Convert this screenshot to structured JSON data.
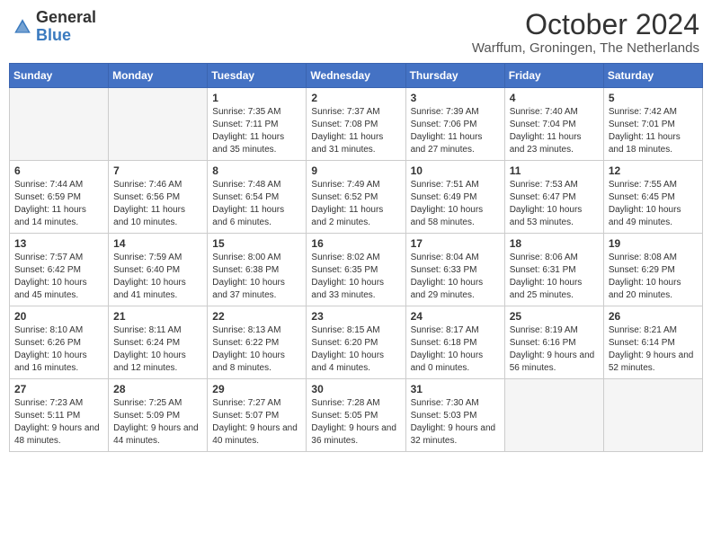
{
  "header": {
    "logo_general": "General",
    "logo_blue": "Blue",
    "month_title": "October 2024",
    "location": "Warffum, Groningen, The Netherlands"
  },
  "days_of_week": [
    "Sunday",
    "Monday",
    "Tuesday",
    "Wednesday",
    "Thursday",
    "Friday",
    "Saturday"
  ],
  "weeks": [
    [
      {
        "day": "",
        "info": ""
      },
      {
        "day": "",
        "info": ""
      },
      {
        "day": "1",
        "info": "Sunrise: 7:35 AM\nSunset: 7:11 PM\nDaylight: 11 hours and 35 minutes."
      },
      {
        "day": "2",
        "info": "Sunrise: 7:37 AM\nSunset: 7:08 PM\nDaylight: 11 hours and 31 minutes."
      },
      {
        "day": "3",
        "info": "Sunrise: 7:39 AM\nSunset: 7:06 PM\nDaylight: 11 hours and 27 minutes."
      },
      {
        "day": "4",
        "info": "Sunrise: 7:40 AM\nSunset: 7:04 PM\nDaylight: 11 hours and 23 minutes."
      },
      {
        "day": "5",
        "info": "Sunrise: 7:42 AM\nSunset: 7:01 PM\nDaylight: 11 hours and 18 minutes."
      }
    ],
    [
      {
        "day": "6",
        "info": "Sunrise: 7:44 AM\nSunset: 6:59 PM\nDaylight: 11 hours and 14 minutes."
      },
      {
        "day": "7",
        "info": "Sunrise: 7:46 AM\nSunset: 6:56 PM\nDaylight: 11 hours and 10 minutes."
      },
      {
        "day": "8",
        "info": "Sunrise: 7:48 AM\nSunset: 6:54 PM\nDaylight: 11 hours and 6 minutes."
      },
      {
        "day": "9",
        "info": "Sunrise: 7:49 AM\nSunset: 6:52 PM\nDaylight: 11 hours and 2 minutes."
      },
      {
        "day": "10",
        "info": "Sunrise: 7:51 AM\nSunset: 6:49 PM\nDaylight: 10 hours and 58 minutes."
      },
      {
        "day": "11",
        "info": "Sunrise: 7:53 AM\nSunset: 6:47 PM\nDaylight: 10 hours and 53 minutes."
      },
      {
        "day": "12",
        "info": "Sunrise: 7:55 AM\nSunset: 6:45 PM\nDaylight: 10 hours and 49 minutes."
      }
    ],
    [
      {
        "day": "13",
        "info": "Sunrise: 7:57 AM\nSunset: 6:42 PM\nDaylight: 10 hours and 45 minutes."
      },
      {
        "day": "14",
        "info": "Sunrise: 7:59 AM\nSunset: 6:40 PM\nDaylight: 10 hours and 41 minutes."
      },
      {
        "day": "15",
        "info": "Sunrise: 8:00 AM\nSunset: 6:38 PM\nDaylight: 10 hours and 37 minutes."
      },
      {
        "day": "16",
        "info": "Sunrise: 8:02 AM\nSunset: 6:35 PM\nDaylight: 10 hours and 33 minutes."
      },
      {
        "day": "17",
        "info": "Sunrise: 8:04 AM\nSunset: 6:33 PM\nDaylight: 10 hours and 29 minutes."
      },
      {
        "day": "18",
        "info": "Sunrise: 8:06 AM\nSunset: 6:31 PM\nDaylight: 10 hours and 25 minutes."
      },
      {
        "day": "19",
        "info": "Sunrise: 8:08 AM\nSunset: 6:29 PM\nDaylight: 10 hours and 20 minutes."
      }
    ],
    [
      {
        "day": "20",
        "info": "Sunrise: 8:10 AM\nSunset: 6:26 PM\nDaylight: 10 hours and 16 minutes."
      },
      {
        "day": "21",
        "info": "Sunrise: 8:11 AM\nSunset: 6:24 PM\nDaylight: 10 hours and 12 minutes."
      },
      {
        "day": "22",
        "info": "Sunrise: 8:13 AM\nSunset: 6:22 PM\nDaylight: 10 hours and 8 minutes."
      },
      {
        "day": "23",
        "info": "Sunrise: 8:15 AM\nSunset: 6:20 PM\nDaylight: 10 hours and 4 minutes."
      },
      {
        "day": "24",
        "info": "Sunrise: 8:17 AM\nSunset: 6:18 PM\nDaylight: 10 hours and 0 minutes."
      },
      {
        "day": "25",
        "info": "Sunrise: 8:19 AM\nSunset: 6:16 PM\nDaylight: 9 hours and 56 minutes."
      },
      {
        "day": "26",
        "info": "Sunrise: 8:21 AM\nSunset: 6:14 PM\nDaylight: 9 hours and 52 minutes."
      }
    ],
    [
      {
        "day": "27",
        "info": "Sunrise: 7:23 AM\nSunset: 5:11 PM\nDaylight: 9 hours and 48 minutes."
      },
      {
        "day": "28",
        "info": "Sunrise: 7:25 AM\nSunset: 5:09 PM\nDaylight: 9 hours and 44 minutes."
      },
      {
        "day": "29",
        "info": "Sunrise: 7:27 AM\nSunset: 5:07 PM\nDaylight: 9 hours and 40 minutes."
      },
      {
        "day": "30",
        "info": "Sunrise: 7:28 AM\nSunset: 5:05 PM\nDaylight: 9 hours and 36 minutes."
      },
      {
        "day": "31",
        "info": "Sunrise: 7:30 AM\nSunset: 5:03 PM\nDaylight: 9 hours and 32 minutes."
      },
      {
        "day": "",
        "info": ""
      },
      {
        "day": "",
        "info": ""
      }
    ]
  ]
}
